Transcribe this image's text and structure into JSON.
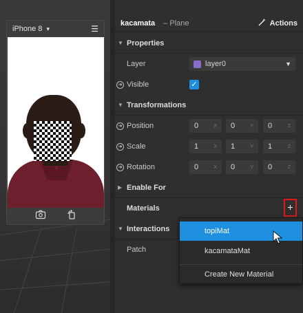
{
  "device": {
    "name": "iPhone 8",
    "chevron": "▾",
    "menu_icon": "☰"
  },
  "inspector": {
    "object_name": "kacamata",
    "object_type": "– Plane",
    "actions_label": "Actions",
    "sections": {
      "properties": "Properties",
      "transformations": "Transformations",
      "enable_for": "Enable For",
      "materials": "Materials",
      "interactions": "Interactions"
    },
    "properties": {
      "layer_label": "Layer",
      "layer_value": "layer0",
      "layer_color": "#8a6fc9",
      "visible_label": "Visible",
      "visible_checked": true
    },
    "transformations": {
      "position_label": "Position",
      "position": [
        "0",
        "0",
        "0"
      ],
      "scale_label": "Scale",
      "scale": [
        "1",
        "1",
        "1"
      ],
      "rotation_label": "Rotation",
      "rotation": [
        "0",
        "0",
        "0"
      ],
      "axes": [
        "X",
        "Y",
        "Z"
      ]
    },
    "materials_add": "+",
    "interactions": {
      "patch_label": "Patch"
    }
  },
  "material_menu": {
    "items": [
      "topiMat",
      "kacamataMat"
    ],
    "selected_index": 0,
    "create_new": "Create New Material"
  },
  "colors": {
    "accent": "#1f8fe0",
    "highlight_box": "#e01818"
  }
}
